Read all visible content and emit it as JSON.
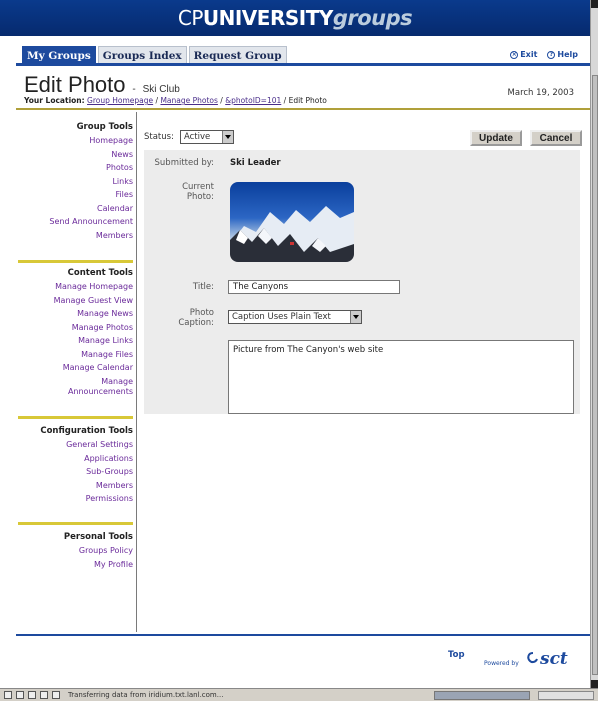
{
  "banner": {
    "logo_cp": "CP",
    "logo_university": "UNIVERSITY",
    "logo_groups": "groups"
  },
  "tabs": [
    {
      "label": "My Groups",
      "active": true
    },
    {
      "label": "Groups Index",
      "active": false
    },
    {
      "label": "Request Group",
      "active": false
    }
  ],
  "top_links": {
    "exit": "Exit",
    "help": "Help"
  },
  "header": {
    "title": "Edit Photo",
    "separator": "-",
    "group_name": "Ski Club",
    "date": "March 19, 2003"
  },
  "breadcrumb": {
    "prefix": "Your Location:",
    "links": [
      "Group Homepage",
      "Manage Photos",
      "&photoID=101"
    ],
    "current": "Edit Photo",
    "sep": " / "
  },
  "sidebar": {
    "group_tools": {
      "heading": "Group Tools",
      "items": [
        "Homepage",
        "News",
        "Photos",
        "Links",
        "Files",
        "Calendar",
        "Send Announcement",
        "Members"
      ]
    },
    "content_tools": {
      "heading": "Content Tools",
      "items": [
        "Manage Homepage",
        "Manage Guest View",
        "Manage News",
        "Manage Photos",
        "Manage Links",
        "Manage Files",
        "Manage Calendar",
        "Manage Announcements"
      ]
    },
    "configuration_tools": {
      "heading": "Configuration Tools",
      "items": [
        "General Settings",
        "Applications",
        "Sub-Groups",
        "Members",
        "Permissions"
      ]
    },
    "personal_tools": {
      "heading": "Personal Tools",
      "items": [
        "Groups Policy",
        "My Profile"
      ]
    }
  },
  "form": {
    "status_label": "Status:",
    "status_value": "Active",
    "update_button": "Update",
    "cancel_button": "Cancel",
    "submitted_by_label": "Submitted by:",
    "submitted_by_value": "Ski Leader",
    "current_photo_label": "Current Photo:",
    "title_label": "Title:",
    "title_value": "The Canyons",
    "caption_label": "Photo Caption:",
    "caption_mode": "Caption Uses Plain Text",
    "caption_value": "Picture from The Canyon's web site"
  },
  "footer": {
    "top_link": "Top",
    "powered_by": "Powered by",
    "logo": "sct"
  },
  "statusbar": {
    "text": "Transferring data from iridium.txt.lanl.com..."
  }
}
